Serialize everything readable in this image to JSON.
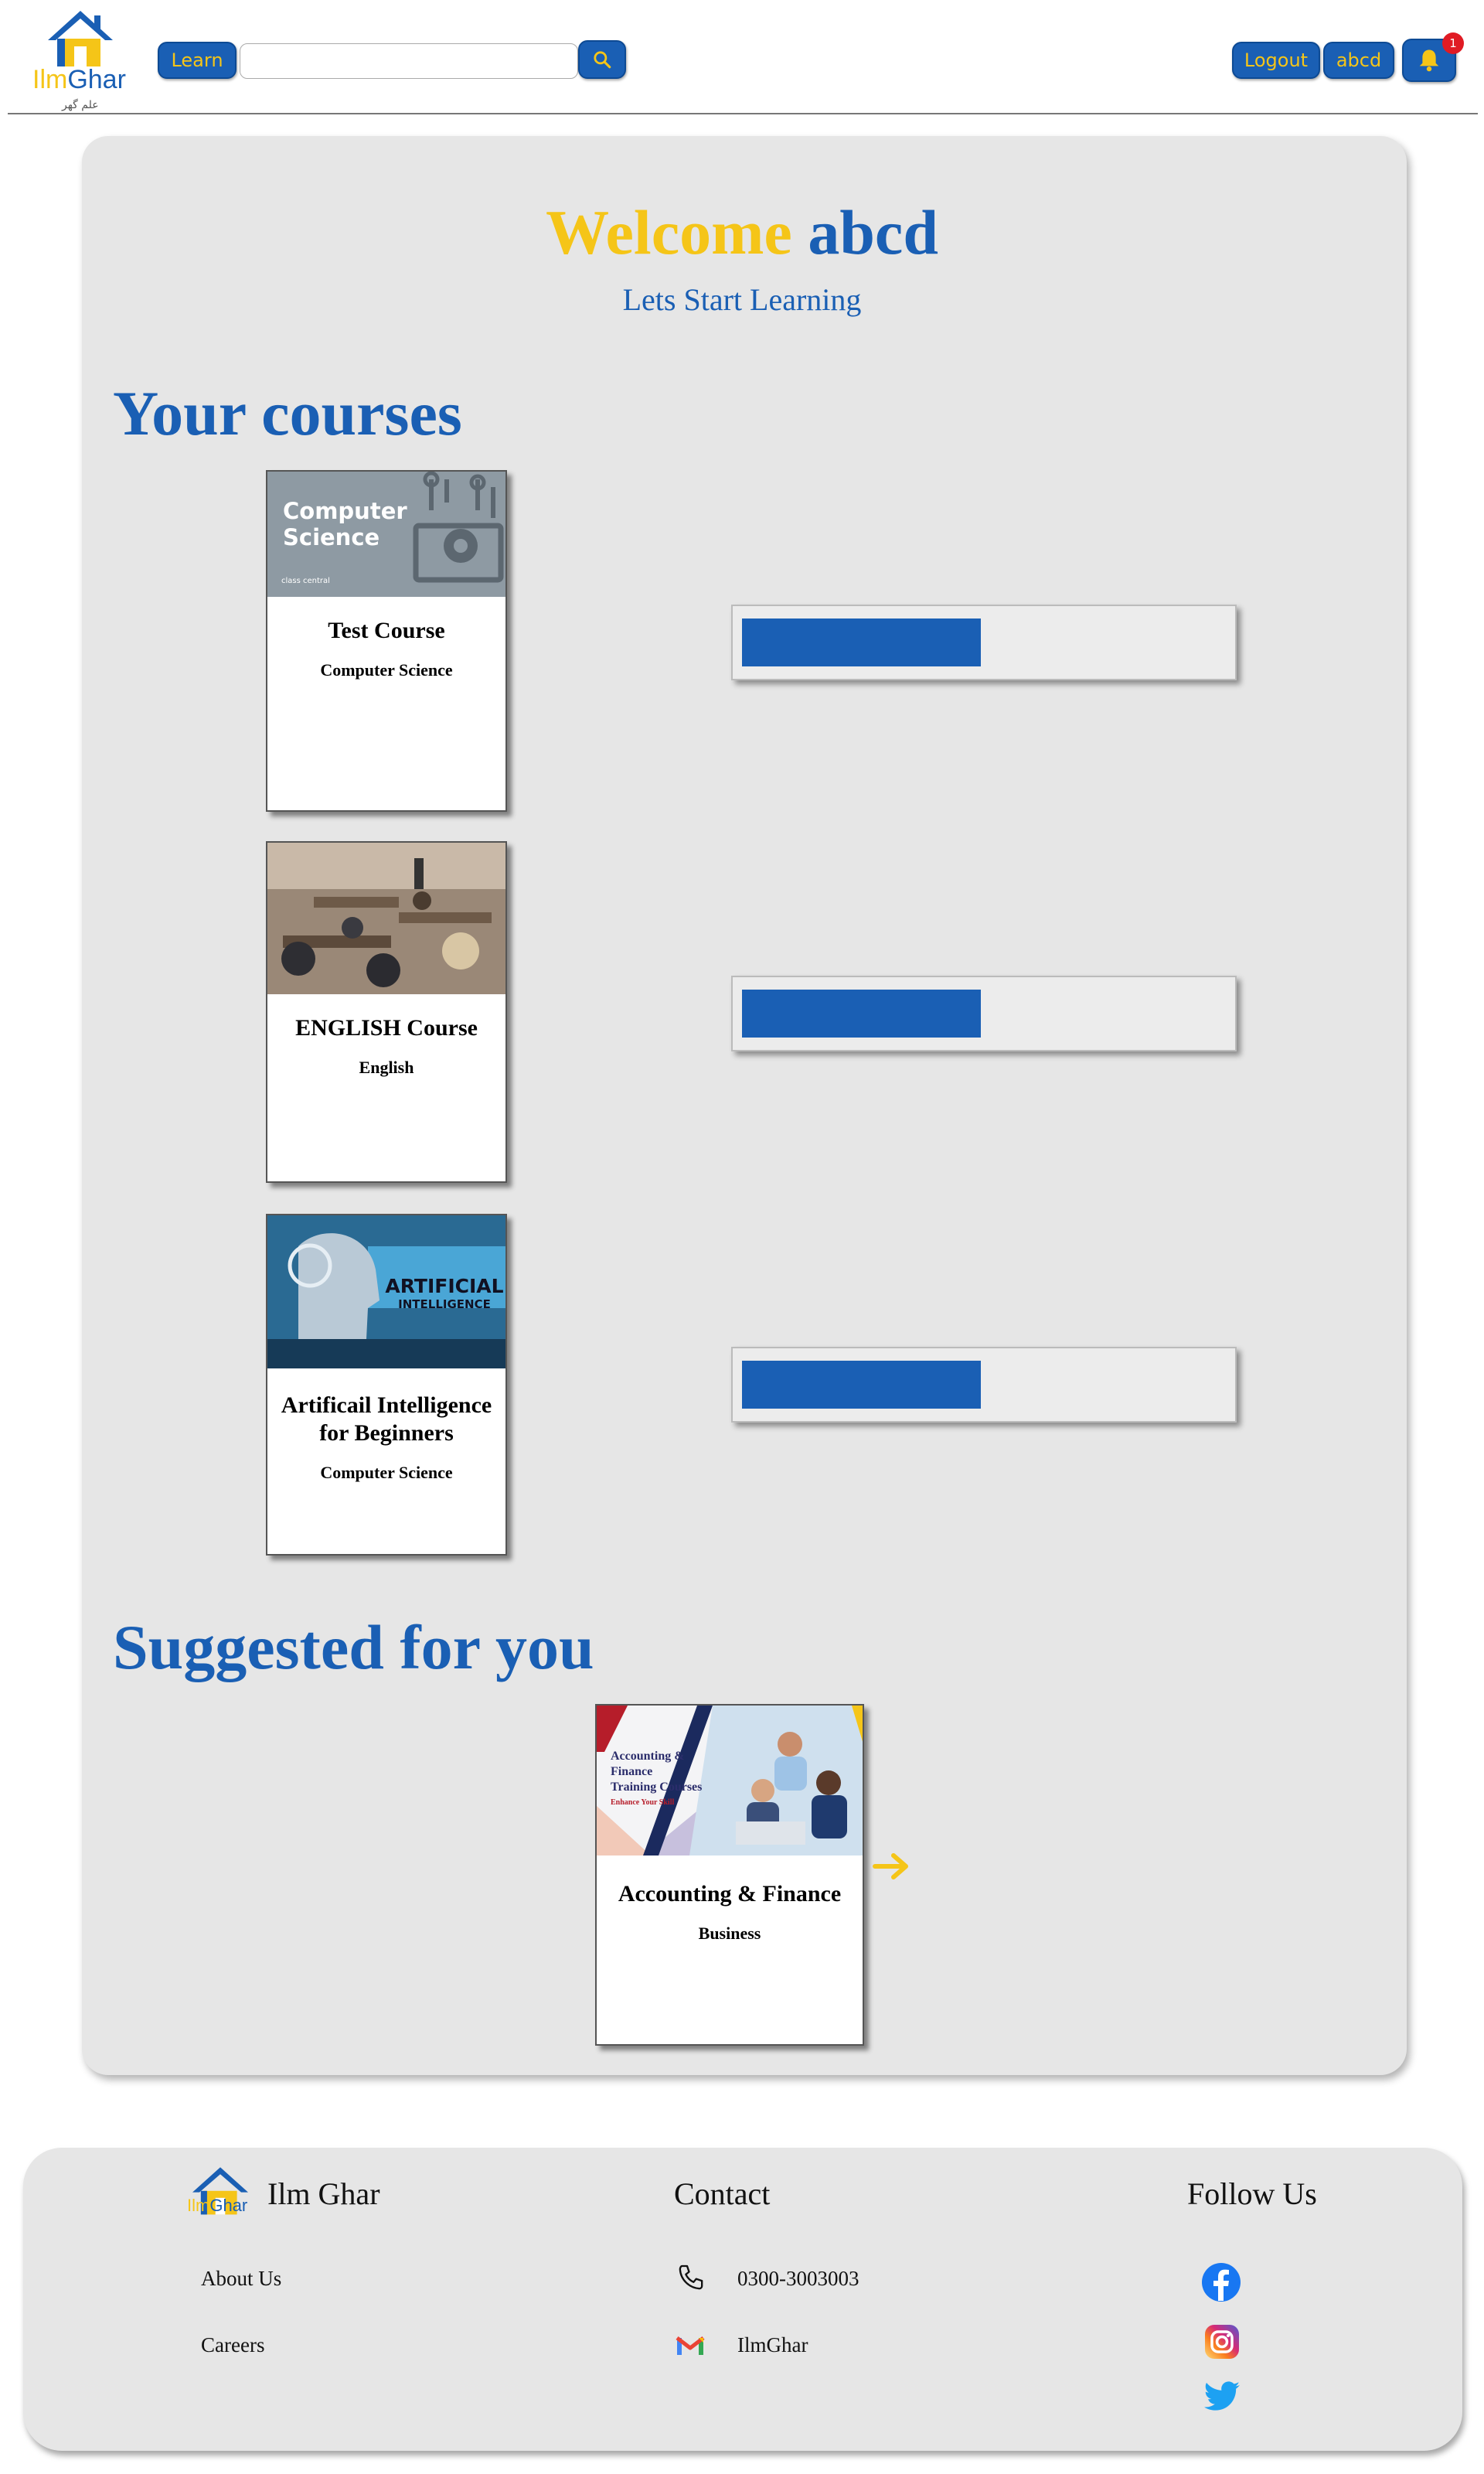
{
  "header": {
    "logo": {
      "ilm": "Ilm",
      "ghar": "Ghar",
      "urdu": "علم گھر"
    },
    "learn_label": "Learn",
    "search": {
      "value": "",
      "placeholder": ""
    },
    "logout_label": "Logout",
    "user_label": "abcd",
    "notification_count": "1"
  },
  "welcome": {
    "word": "Welcome",
    "name": "abcd",
    "subtitle": "Lets Start Learning"
  },
  "your_courses": {
    "title": "Your courses",
    "courses": [
      {
        "title": "Test Course",
        "category": "Computer Science",
        "image_text": [
          "Computer",
          "Science"
        ],
        "image_brand": "class central",
        "progress": 0.49
      },
      {
        "title": "ENGLISH Course",
        "category": "English",
        "progress": 0.49
      },
      {
        "title": "Artificail Intelligence for Beginners",
        "category": "Computer Science",
        "image_text": [
          "ARTIFICIAL",
          "INTELLIGENCE"
        ],
        "progress": 0.49
      }
    ]
  },
  "suggested": {
    "title": "Suggested for you",
    "courses": [
      {
        "title": "Accounting & Finance",
        "category": "Business",
        "image_text": [
          "Accounting &",
          "Finance",
          "Training Courses",
          "Enhance Your Skill"
        ]
      }
    ]
  },
  "footer": {
    "brand": "Ilm Ghar",
    "logo": {
      "ilm": "Ilm",
      "ghar": "Ghar"
    },
    "links": [
      "About Us",
      "Careers"
    ],
    "contact": {
      "heading": "Contact",
      "phone": "0300-3003003",
      "email": "IlmGhar"
    },
    "follow": {
      "heading": "Follow Us",
      "icons": [
        "facebook-icon",
        "instagram-icon",
        "twitter-icon"
      ]
    }
  },
  "colors": {
    "brand_blue": "#1a5fb4",
    "brand_yellow": "#f5c518",
    "panel_grey": "#e6e6e6",
    "badge_red": "#e01b24"
  }
}
